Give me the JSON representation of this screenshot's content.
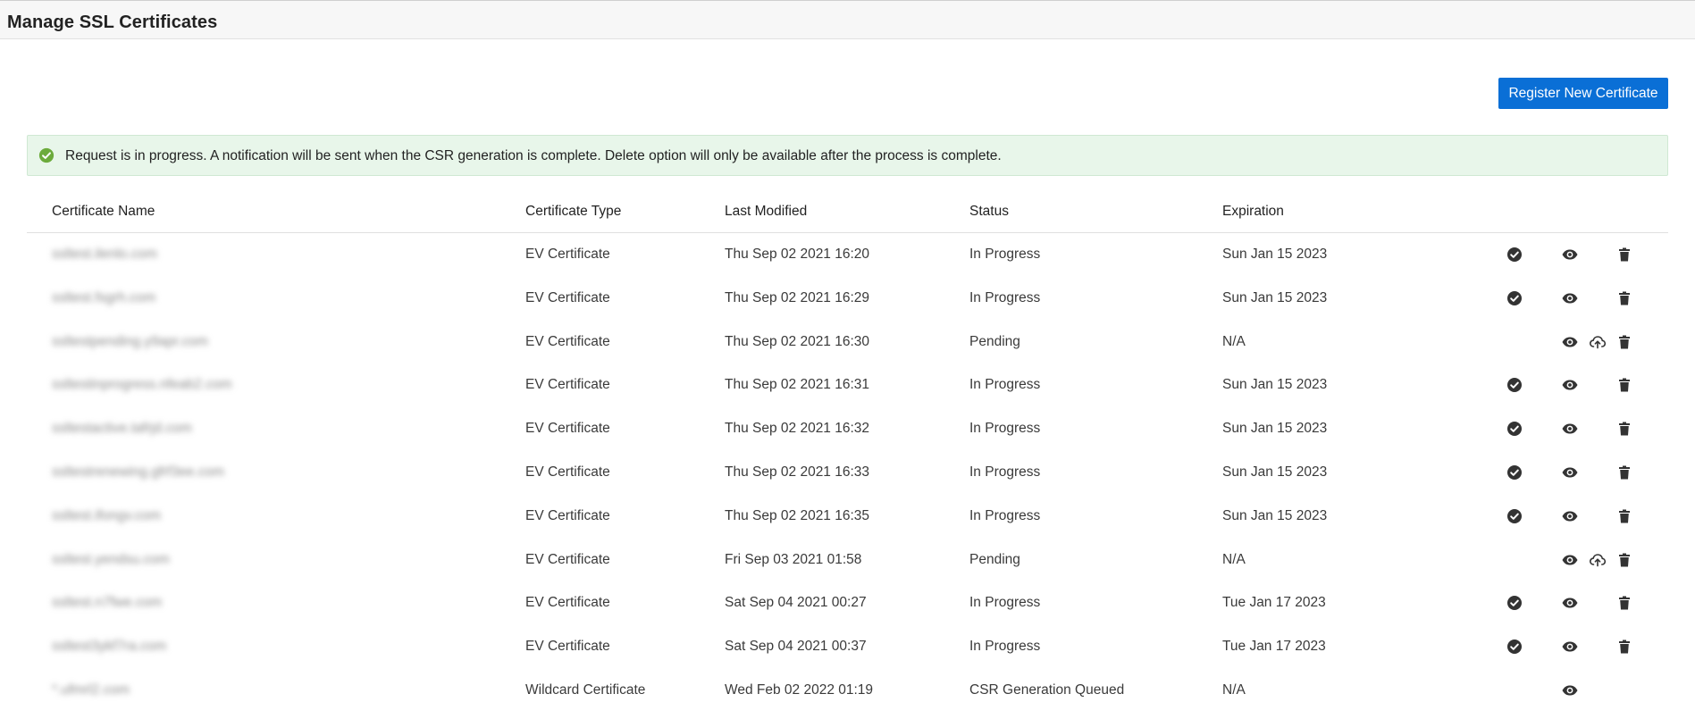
{
  "page": {
    "title": "Manage SSL Certificates"
  },
  "toolbar": {
    "register_label": "Register New Certificate"
  },
  "alert": {
    "message": "Request is in progress. A notification will be sent when the CSR generation is complete. Delete option will only be available after the process is complete.",
    "icon": "check-circle-icon",
    "color": "#6cab3c"
  },
  "table": {
    "headers": {
      "name": "Certificate Name",
      "type": "Certificate Type",
      "modified": "Last Modified",
      "status": "Status",
      "expiration": "Expiration"
    },
    "rows": [
      {
        "name": "ssltest.ilenlo.com",
        "type": "EV Certificate",
        "modified": "Thu Sep 02 2021 16:20",
        "status": "In Progress",
        "expiration": "Sun Jan 15 2023",
        "actions": [
          "approve",
          "view",
          "delete"
        ]
      },
      {
        "name": "ssltest.fsgrh.com",
        "type": "EV Certificate",
        "modified": "Thu Sep 02 2021 16:29",
        "status": "In Progress",
        "expiration": "Sun Jan 15 2023",
        "actions": [
          "approve",
          "view",
          "delete"
        ]
      },
      {
        "name": "ssltestpending.y9apr.com",
        "type": "EV Certificate",
        "modified": "Thu Sep 02 2021 16:30",
        "status": "Pending",
        "expiration": "N/A",
        "actions": [
          "view",
          "upload",
          "delete"
        ]
      },
      {
        "name": "ssltestinprogress.nfeab2.com",
        "type": "EV Certificate",
        "modified": "Thu Sep 02 2021 16:31",
        "status": "In Progress",
        "expiration": "Sun Jan 15 2023",
        "actions": [
          "approve",
          "view",
          "delete"
        ]
      },
      {
        "name": "ssltestactive.tafrjd.com",
        "type": "EV Certificate",
        "modified": "Thu Sep 02 2021 16:32",
        "status": "In Progress",
        "expiration": "Sun Jan 15 2023",
        "actions": [
          "approve",
          "view",
          "delete"
        ]
      },
      {
        "name": "ssltestrenewing.gfrf3ee.com",
        "type": "EV Certificate",
        "modified": "Thu Sep 02 2021 16:33",
        "status": "In Progress",
        "expiration": "Sun Jan 15 2023",
        "actions": [
          "approve",
          "view",
          "delete"
        ]
      },
      {
        "name": "ssltest.ifongv.com",
        "type": "EV Certificate",
        "modified": "Thu Sep 02 2021 16:35",
        "status": "In Progress",
        "expiration": "Sun Jan 15 2023",
        "actions": [
          "approve",
          "view",
          "delete"
        ]
      },
      {
        "name": "ssltest.yendsu.com",
        "type": "EV Certificate",
        "modified": "Fri Sep 03 2021 01:58",
        "status": "Pending",
        "expiration": "N/A",
        "actions": [
          "view",
          "upload",
          "delete"
        ]
      },
      {
        "name": "ssltest.n7fwe.com",
        "type": "EV Certificate",
        "modified": "Sat Sep 04 2021 00:27",
        "status": "In Progress",
        "expiration": "Tue Jan 17 2023",
        "actions": [
          "approve",
          "view",
          "delete"
        ]
      },
      {
        "name": "ssltest3ykf7ra.com",
        "type": "EV Certificate",
        "modified": "Sat Sep 04 2021 00:37",
        "status": "In Progress",
        "expiration": "Tue Jan 17 2023",
        "actions": [
          "approve",
          "view",
          "delete"
        ]
      },
      {
        "name": "*.ufmrl2.com",
        "type": "Wildcard Certificate",
        "modified": "Wed Feb 02 2022 01:19",
        "status": "CSR Generation Queued",
        "expiration": "N/A",
        "actions": [
          "view"
        ]
      }
    ]
  },
  "icons": {
    "approve": "check-circle-icon",
    "view": "eye-icon",
    "upload": "cloud-upload-icon",
    "delete": "trash-icon"
  },
  "colors": {
    "primary": "#0a6fd6",
    "alert_bg": "#e8f6ea",
    "icon": "#333333"
  }
}
